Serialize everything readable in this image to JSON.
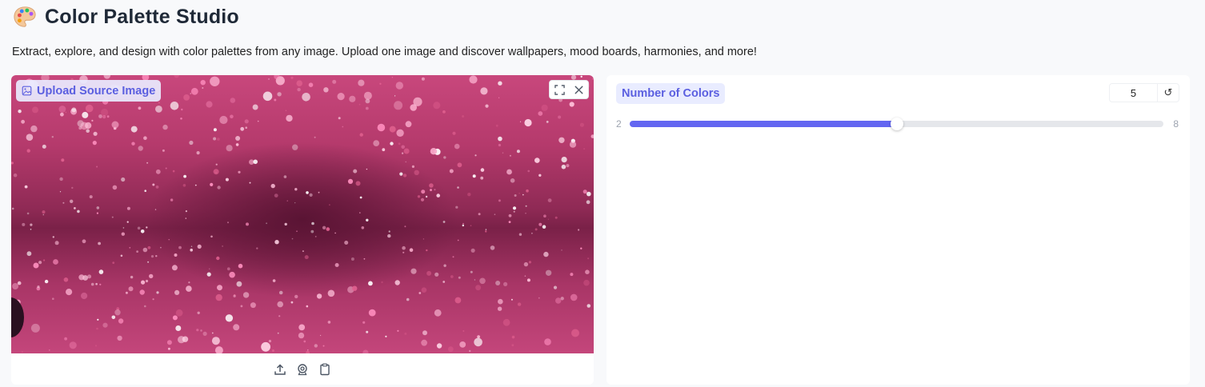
{
  "app": {
    "icon": "artist-palette-icon",
    "title": "Color Palette Studio",
    "subtitle": "Extract, explore, and design with color palettes from any image. Upload one image and discover wallpapers, mood boards, harmonies, and more!"
  },
  "source_image": {
    "label": "Upload Source Image",
    "label_icon": "image-icon",
    "controls": [
      "fullscreen-icon",
      "close-icon"
    ],
    "toolbar": [
      "upload-icon",
      "webcam-icon",
      "clipboard-icon"
    ]
  },
  "color_count": {
    "label": "Number of Colors",
    "value": "5",
    "reset_symbol": "↺",
    "min": "2",
    "max": "8",
    "current": 5,
    "range": [
      2,
      8
    ]
  },
  "colors": {
    "accent": "#6366f1",
    "label_bg": "#e9ecff",
    "label_text": "#5b5fe0",
    "page_bg": "#f8f9fb"
  }
}
